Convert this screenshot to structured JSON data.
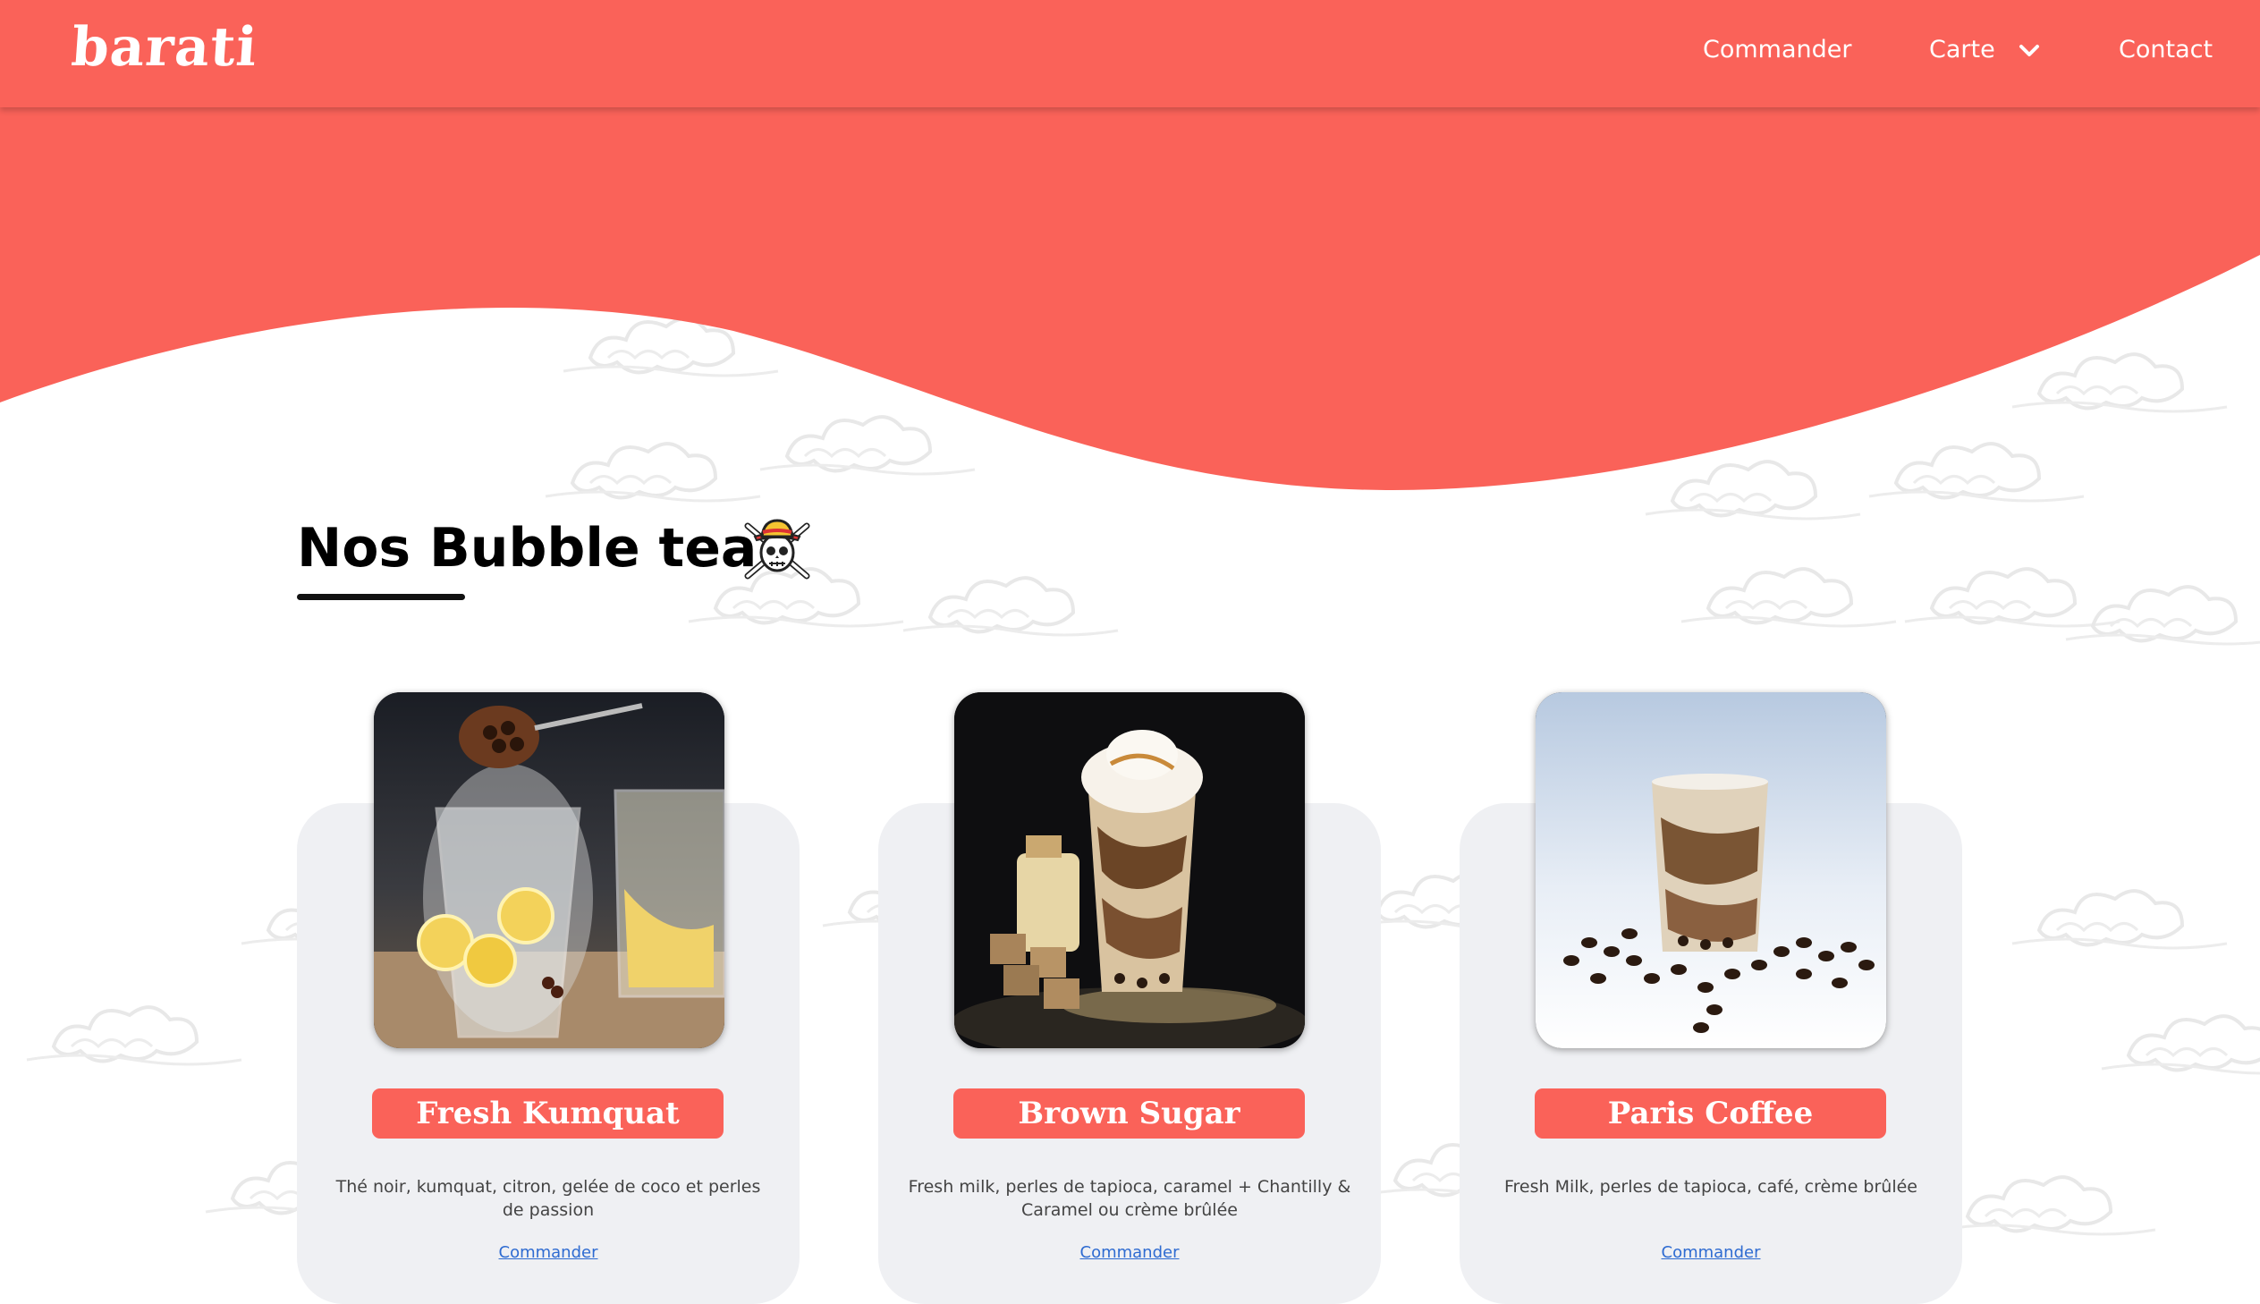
{
  "nav": {
    "logo": "barati",
    "commander": "Commander",
    "carte": "Carte",
    "contact": "Contact"
  },
  "section": {
    "title": "Nos Bubble tea"
  },
  "products": [
    {
      "name": "Fresh Kumquat",
      "description": "Thé noir, kumquat, citron, gelée de coco et perles de passion",
      "order_label": "Commander"
    },
    {
      "name": "Brown Sugar",
      "description": "Fresh milk, perles de tapioca, caramel + Chantilly & Caramel ou crème brûlée",
      "order_label": "Commander"
    },
    {
      "name": "Paris Coffee",
      "description": "Fresh Milk, perles de tapioca, café, crème brûlée",
      "order_label": "Commander"
    }
  ],
  "colors": {
    "brand": "#fa6259",
    "card_background": "#eff0f3",
    "link": "#2e6bd1"
  },
  "icons": [
    "chevron-down-icon",
    "straw-hat-skull-icon"
  ]
}
